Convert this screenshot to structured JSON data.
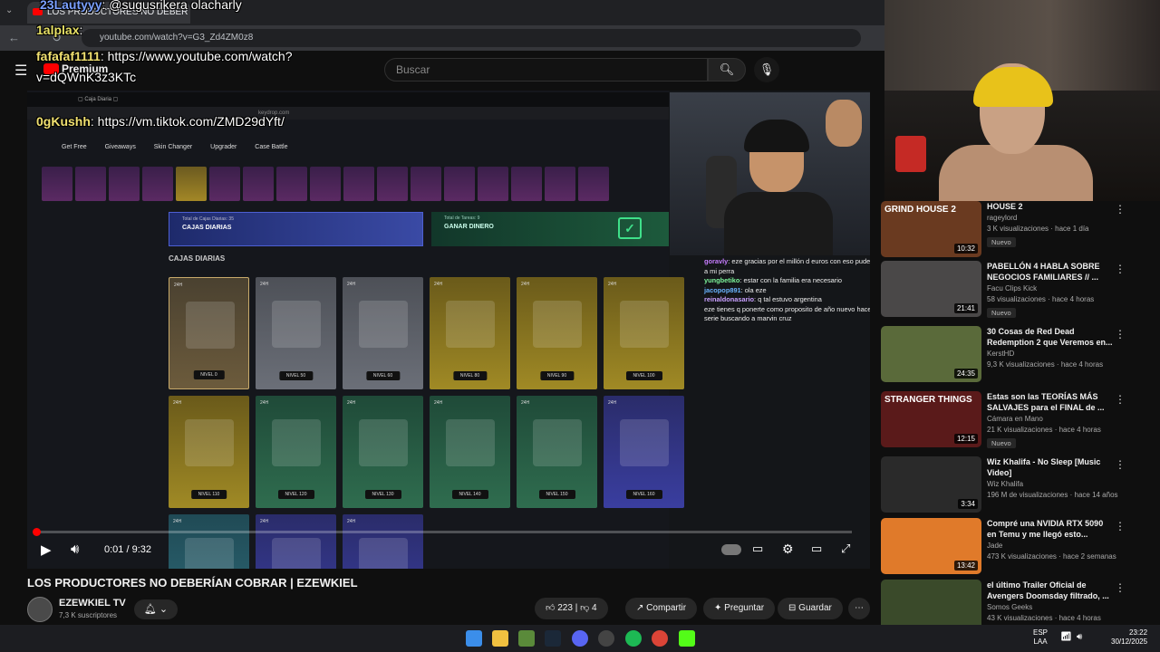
{
  "browser": {
    "tab_title": "LOS PRODUCTORES NO DEBER",
    "url": "youtube.com/watch?v=G3_Zd4ZM0z8"
  },
  "youtube": {
    "logo_text": "Premium",
    "search_placeholder": "Buscar"
  },
  "stream_chat": [
    {
      "user": "23Lautyyy",
      "message": ": @sugusrikera",
      "extra": "olacharly"
    },
    {
      "user": "1alplax",
      "message": ":"
    },
    {
      "user": "fafafaf1111",
      "message": ": https://www.youtube.com/watch?"
    },
    {
      "user": "",
      "message": "v=dQWnK3z3KTc"
    },
    {
      "user": "0gKushh",
      "message": ": https://vm.tiktok.com/ZMD29dYft/"
    }
  ],
  "video": {
    "site_nav": [
      "Get Free",
      "Giveaways",
      "Skin Changer",
      "Upgrader",
      "Case Battle"
    ],
    "banner_daily_small": "Total de Cajas Diarias: 35",
    "banner_daily": "CAJAS DIARIAS",
    "banner_money_small": "Total de Tareas: 9",
    "banner_money": "GANAR DINERO",
    "section_title": "CAJAS DIARIAS",
    "cases": [
      {
        "tag": "24H",
        "level": "NIVEL 0",
        "color": "tan"
      },
      {
        "tag": "24H",
        "level": "NIVEL 50",
        "color": "grey"
      },
      {
        "tag": "24H",
        "level": "NIVEL 60",
        "color": "grey"
      },
      {
        "tag": "24H",
        "level": "NIVEL 80",
        "color": "gold"
      },
      {
        "tag": "24H",
        "level": "NIVEL 90",
        "color": "gold"
      },
      {
        "tag": "24H",
        "level": "NIVEL 100",
        "color": "gold"
      },
      {
        "tag": "24H",
        "level": "NIVEL 110",
        "color": "gold"
      },
      {
        "tag": "24H",
        "level": "NIVEL 120",
        "color": "green"
      },
      {
        "tag": "24H",
        "level": "NIVEL 130",
        "color": "green"
      },
      {
        "tag": "24H",
        "level": "NIVEL 140",
        "color": "green"
      },
      {
        "tag": "24H",
        "level": "NIVEL 150",
        "color": "green"
      },
      {
        "tag": "24H",
        "level": "NIVEL 160",
        "color": "blue"
      },
      {
        "tag": "24H",
        "level": "",
        "color": "teal"
      },
      {
        "tag": "24H",
        "level": "",
        "color": "blue"
      },
      {
        "tag": "24H",
        "level": "",
        "color": "blue"
      }
    ],
    "twitch_chat": [
      {
        "user": "goravly",
        "message": ": eze gracias por el millón d euros con eso pude salvar a mi perra",
        "color": "#c77dff"
      },
      {
        "user": "yungbetiko",
        "message": ": estar con la familia era necesario",
        "color": "#7cf59a"
      },
      {
        "user": "jacopop891",
        "message": ": ola eze",
        "color": "#6ab4ff"
      },
      {
        "user": "reinaldonasario",
        "message": ": q tal estuvo argentina",
        "color": "#c9a0ff"
      },
      {
        "user": "",
        "message": "eze tienes q ponerte como proposito de año nuevo hacer una serie buscando a marvin cruz",
        "color": "#ff80c0"
      }
    ],
    "time_current": "0:01",
    "time_total": "9:32",
    "progress": 0.002
  },
  "watch": {
    "title": "LOS PRODUCTORES NO DEBERÍAN COBRAR | EZEWKIEL",
    "channel": "EZEWKIEL TV",
    "subscribers": "7,3 K suscriptores",
    "likes": "223",
    "dislikes": "4",
    "share": "Compartir",
    "ask": "Preguntar",
    "save": "Guardar"
  },
  "recommendations": [
    {
      "title": "HOUSE 2",
      "channel": "rageylord",
      "meta": "3 K visualizaciones · hace 1 día",
      "duration": "10:32",
      "badge": "Nuevo",
      "thumb": "#6a3a20",
      "thumb_text": "GRIND HOUSE 2"
    },
    {
      "title": "PABELLÓN 4 HABLA SOBRE NEGOCIOS FAMILIARES // ...",
      "channel": "Facu Clips Kick",
      "meta": "58 visualizaciones · hace 4 horas",
      "duration": "21:41",
      "badge": "Nuevo",
      "thumb": "#4a4848",
      "thumb_text": ""
    },
    {
      "title": "30 Cosas de Red Dead Redemption 2 que Veremos en...",
      "channel": "KerstHD",
      "meta": "9,3 K visualizaciones · hace 4 horas",
      "duration": "24:35",
      "badge": "",
      "thumb": "#5a6a3a",
      "thumb_text": ""
    },
    {
      "title": "Estas son las TEORÍAS MÁS SALVAJES para el FINAL de ...",
      "channel": "Cámara en Mano",
      "meta": "21 K visualizaciones · hace 4 horas",
      "duration": "12:15",
      "badge": "Nuevo",
      "thumb": "#5a1a1a",
      "thumb_text": "STRANGER THINGS"
    },
    {
      "title": "Wiz Khalifa - No Sleep [Music Video]",
      "channel": "Wiz Khalifa",
      "meta": "196 M de visualizaciones · hace 14 años",
      "duration": "3:34",
      "badge": "",
      "thumb": "#2a2a2a",
      "thumb_text": ""
    },
    {
      "title": "Compré una NVIDIA RTX 5090 en Temu y me llegó esto...",
      "channel": "Jade",
      "meta": "473 K visualizaciones · hace 2 semanas",
      "duration": "13:42",
      "badge": "",
      "thumb": "#e07a2a",
      "thumb_text": ""
    },
    {
      "title": "el último Trailer Oficial de Avengers Doomsday filtrado, ...",
      "channel": "Somos Geeks",
      "meta": "43 K visualizaciones · hace 4 horas",
      "duration": "",
      "badge": "",
      "thumb": "#3a4a2a",
      "thumb_text": ""
    }
  ],
  "taskbar": {
    "lang_top": "ESP",
    "lang_bottom": "LAA",
    "time": "23:22",
    "date": "30/12/2025"
  }
}
